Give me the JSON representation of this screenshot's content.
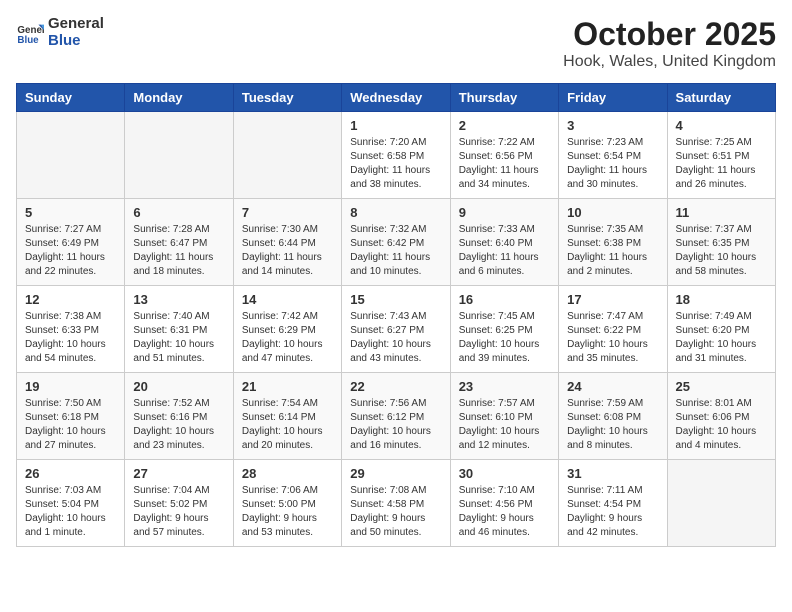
{
  "header": {
    "logo_general": "General",
    "logo_blue": "Blue",
    "month": "October 2025",
    "location": "Hook, Wales, United Kingdom"
  },
  "weekdays": [
    "Sunday",
    "Monday",
    "Tuesday",
    "Wednesday",
    "Thursday",
    "Friday",
    "Saturday"
  ],
  "weeks": [
    [
      {
        "day": "",
        "info": ""
      },
      {
        "day": "",
        "info": ""
      },
      {
        "day": "",
        "info": ""
      },
      {
        "day": "1",
        "info": "Sunrise: 7:20 AM\nSunset: 6:58 PM\nDaylight: 11 hours\nand 38 minutes."
      },
      {
        "day": "2",
        "info": "Sunrise: 7:22 AM\nSunset: 6:56 PM\nDaylight: 11 hours\nand 34 minutes."
      },
      {
        "day": "3",
        "info": "Sunrise: 7:23 AM\nSunset: 6:54 PM\nDaylight: 11 hours\nand 30 minutes."
      },
      {
        "day": "4",
        "info": "Sunrise: 7:25 AM\nSunset: 6:51 PM\nDaylight: 11 hours\nand 26 minutes."
      }
    ],
    [
      {
        "day": "5",
        "info": "Sunrise: 7:27 AM\nSunset: 6:49 PM\nDaylight: 11 hours\nand 22 minutes."
      },
      {
        "day": "6",
        "info": "Sunrise: 7:28 AM\nSunset: 6:47 PM\nDaylight: 11 hours\nand 18 minutes."
      },
      {
        "day": "7",
        "info": "Sunrise: 7:30 AM\nSunset: 6:44 PM\nDaylight: 11 hours\nand 14 minutes."
      },
      {
        "day": "8",
        "info": "Sunrise: 7:32 AM\nSunset: 6:42 PM\nDaylight: 11 hours\nand 10 minutes."
      },
      {
        "day": "9",
        "info": "Sunrise: 7:33 AM\nSunset: 6:40 PM\nDaylight: 11 hours\nand 6 minutes."
      },
      {
        "day": "10",
        "info": "Sunrise: 7:35 AM\nSunset: 6:38 PM\nDaylight: 11 hours\nand 2 minutes."
      },
      {
        "day": "11",
        "info": "Sunrise: 7:37 AM\nSunset: 6:35 PM\nDaylight: 10 hours\nand 58 minutes."
      }
    ],
    [
      {
        "day": "12",
        "info": "Sunrise: 7:38 AM\nSunset: 6:33 PM\nDaylight: 10 hours\nand 54 minutes."
      },
      {
        "day": "13",
        "info": "Sunrise: 7:40 AM\nSunset: 6:31 PM\nDaylight: 10 hours\nand 51 minutes."
      },
      {
        "day": "14",
        "info": "Sunrise: 7:42 AM\nSunset: 6:29 PM\nDaylight: 10 hours\nand 47 minutes."
      },
      {
        "day": "15",
        "info": "Sunrise: 7:43 AM\nSunset: 6:27 PM\nDaylight: 10 hours\nand 43 minutes."
      },
      {
        "day": "16",
        "info": "Sunrise: 7:45 AM\nSunset: 6:25 PM\nDaylight: 10 hours\nand 39 minutes."
      },
      {
        "day": "17",
        "info": "Sunrise: 7:47 AM\nSunset: 6:22 PM\nDaylight: 10 hours\nand 35 minutes."
      },
      {
        "day": "18",
        "info": "Sunrise: 7:49 AM\nSunset: 6:20 PM\nDaylight: 10 hours\nand 31 minutes."
      }
    ],
    [
      {
        "day": "19",
        "info": "Sunrise: 7:50 AM\nSunset: 6:18 PM\nDaylight: 10 hours\nand 27 minutes."
      },
      {
        "day": "20",
        "info": "Sunrise: 7:52 AM\nSunset: 6:16 PM\nDaylight: 10 hours\nand 23 minutes."
      },
      {
        "day": "21",
        "info": "Sunrise: 7:54 AM\nSunset: 6:14 PM\nDaylight: 10 hours\nand 20 minutes."
      },
      {
        "day": "22",
        "info": "Sunrise: 7:56 AM\nSunset: 6:12 PM\nDaylight: 10 hours\nand 16 minutes."
      },
      {
        "day": "23",
        "info": "Sunrise: 7:57 AM\nSunset: 6:10 PM\nDaylight: 10 hours\nand 12 minutes."
      },
      {
        "day": "24",
        "info": "Sunrise: 7:59 AM\nSunset: 6:08 PM\nDaylight: 10 hours\nand 8 minutes."
      },
      {
        "day": "25",
        "info": "Sunrise: 8:01 AM\nSunset: 6:06 PM\nDaylight: 10 hours\nand 4 minutes."
      }
    ],
    [
      {
        "day": "26",
        "info": "Sunrise: 7:03 AM\nSunset: 5:04 PM\nDaylight: 10 hours\nand 1 minute."
      },
      {
        "day": "27",
        "info": "Sunrise: 7:04 AM\nSunset: 5:02 PM\nDaylight: 9 hours\nand 57 minutes."
      },
      {
        "day": "28",
        "info": "Sunrise: 7:06 AM\nSunset: 5:00 PM\nDaylight: 9 hours\nand 53 minutes."
      },
      {
        "day": "29",
        "info": "Sunrise: 7:08 AM\nSunset: 4:58 PM\nDaylight: 9 hours\nand 50 minutes."
      },
      {
        "day": "30",
        "info": "Sunrise: 7:10 AM\nSunset: 4:56 PM\nDaylight: 9 hours\nand 46 minutes."
      },
      {
        "day": "31",
        "info": "Sunrise: 7:11 AM\nSunset: 4:54 PM\nDaylight: 9 hours\nand 42 minutes."
      },
      {
        "day": "",
        "info": ""
      }
    ]
  ]
}
